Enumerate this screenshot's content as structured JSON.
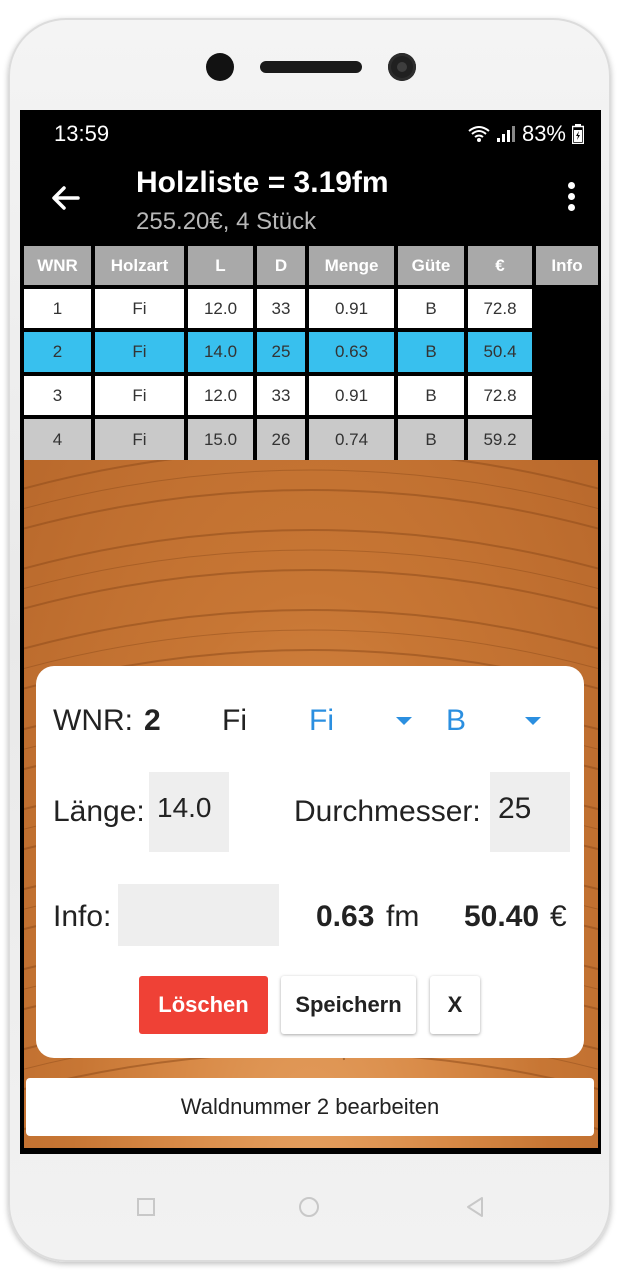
{
  "status_bar": {
    "time": "13:59",
    "battery": "83%"
  },
  "app_bar": {
    "title": "Holzliste = 3.19fm",
    "subtitle": "255.20€, 4 Stück"
  },
  "table": {
    "headers": [
      "WNR",
      "Holzart",
      "L",
      "D",
      "Menge",
      "Güte",
      "€",
      "Info"
    ],
    "rows": [
      [
        "1",
        "Fi",
        "12.0",
        "33",
        "0.91",
        "B",
        "72.8"
      ],
      [
        "2",
        "Fi",
        "14.0",
        "25",
        "0.63",
        "B",
        "50.4"
      ],
      [
        "3",
        "Fi",
        "12.0",
        "33",
        "0.91",
        "B",
        "72.8"
      ],
      [
        "4",
        "Fi",
        "15.0",
        "26",
        "0.74",
        "B",
        "59.2"
      ]
    ],
    "selected_row": 2
  },
  "dialog": {
    "wnr_label": "WNR:",
    "wnr_value": "2",
    "holzart_text": "Fi",
    "holzart_select": "Fi",
    "guete_select": "B",
    "laenge_label": "Länge:",
    "laenge_value": "14.0",
    "durchmesser_label": "Durchmesser:",
    "durchmesser_value": "25",
    "info_label": "Info:",
    "info_value": "",
    "menge_value": "0.63",
    "menge_unit": "fm",
    "preis_value": "50.40",
    "preis_unit": "€",
    "delete_label": "Löschen",
    "save_label": "Speichern",
    "close_label": "X"
  },
  "snackbar": {
    "text": "Waldnummer 2 bearbeiten"
  },
  "colors": {
    "selected_row": "#38c0ee",
    "delete_button": "#ef4136",
    "spinner": "#2b8fe0",
    "header": "#a9a9a9"
  }
}
